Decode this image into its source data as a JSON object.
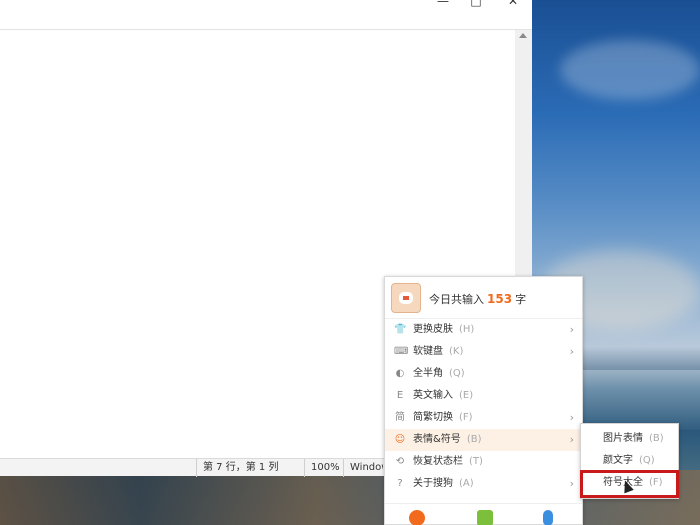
{
  "window": {
    "title_buttons": {
      "minimize": "—",
      "maximize": "□",
      "close": "✕"
    }
  },
  "statusbar": {
    "position": "第 7 行，第 1 列",
    "zoom": "100%",
    "line_ending": "Windows"
  },
  "ime_menu": {
    "today_label": "今日共输入",
    "today_count": "153",
    "today_unit": "字",
    "items": [
      {
        "label": "更换皮肤",
        "key": "(H)",
        "icon": "shirt-icon",
        "has_submenu": true
      },
      {
        "label": "软键盘",
        "key": "(K)",
        "icon": "keyboard-icon",
        "has_submenu": true
      },
      {
        "label": "全半角",
        "key": "(Q)",
        "icon": "moon-icon",
        "has_submenu": false
      },
      {
        "label": "英文输入",
        "key": "(E)",
        "icon": "english-icon",
        "has_submenu": false
      },
      {
        "label": "简繁切换",
        "key": "(F)",
        "icon": "simplified-icon",
        "has_submenu": true
      },
      {
        "label": "表情&符号",
        "key": "(B)",
        "icon": "smiley-icon",
        "has_submenu": true,
        "active": true
      },
      {
        "label": "恢复状态栏",
        "key": "(T)",
        "icon": "restore-icon",
        "has_submenu": false
      },
      {
        "label": "关于搜狗",
        "key": "(A)",
        "icon": "help-icon",
        "has_submenu": true
      }
    ],
    "footer_icons": [
      "settings-icon",
      "toolbox-icon",
      "microphone-icon"
    ],
    "colors": {
      "accent": "#f26b1d",
      "active_bg": "#fdf1e6"
    }
  },
  "submenu": {
    "items": [
      {
        "label": "图片表情",
        "key": "(B)"
      },
      {
        "label": "颜文字",
        "key": "(Q)"
      },
      {
        "label": "符号大全",
        "key": "(F)"
      }
    ],
    "highlight_color": "#c81a1a"
  }
}
